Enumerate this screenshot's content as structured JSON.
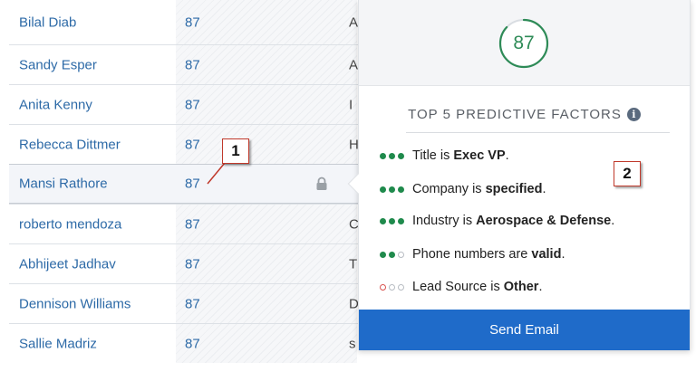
{
  "rows": [
    {
      "name": "Bilal Diab",
      "score": "87",
      "trail": "A"
    },
    {
      "name": "Sandy Esper",
      "score": "87",
      "trail": "A"
    },
    {
      "name": "Anita Kenny",
      "score": "87",
      "trail": "I"
    },
    {
      "name": "Rebecca Dittmer",
      "score": "87",
      "trail": "H"
    },
    {
      "name": "Mansi Rathore",
      "score": "87",
      "trail": ""
    },
    {
      "name": "roberto mendoza",
      "score": "87",
      "trail": "C"
    },
    {
      "name": "Abhijeet Jadhav",
      "score": "87",
      "trail": "T"
    },
    {
      "name": "Dennison Williams",
      "score": "87",
      "trail": "D"
    },
    {
      "name": "Sallie Madriz",
      "score": "87",
      "trail": "s"
    }
  ],
  "selected_row_index": 4,
  "callouts": {
    "one": "1",
    "two": "2"
  },
  "popover": {
    "score": "87",
    "score_fraction": 0.87,
    "factors_title": "TOP 5 PREDICTIVE FACTORS",
    "info_glyph": "i",
    "factors": [
      {
        "prefix": "Title is ",
        "value": "Exec VP",
        "suffix": ".",
        "strength": [
          "on",
          "on",
          "on"
        ]
      },
      {
        "prefix": "Company is ",
        "value": "specified",
        "suffix": ".",
        "strength": [
          "on",
          "on",
          "on"
        ]
      },
      {
        "prefix": "Industry is ",
        "value": "Aerospace & Defense",
        "suffix": ".",
        "strength": [
          "on",
          "on",
          "on"
        ]
      },
      {
        "prefix": "Phone numbers are ",
        "value": "valid",
        "suffix": ".",
        "strength": [
          "on",
          "on",
          "off"
        ]
      },
      {
        "prefix": "Lead Source is ",
        "value": "Other",
        "suffix": ".",
        "strength": [
          "neg",
          "off",
          "off"
        ]
      }
    ],
    "send_button": "Send Email"
  },
  "colors": {
    "link": "#2d6aa7",
    "positive": "#1f8a4c",
    "negative": "#d9534f",
    "button": "#1f6bc9"
  },
  "icons": {
    "lock": "lock-icon",
    "info": "info-icon"
  }
}
